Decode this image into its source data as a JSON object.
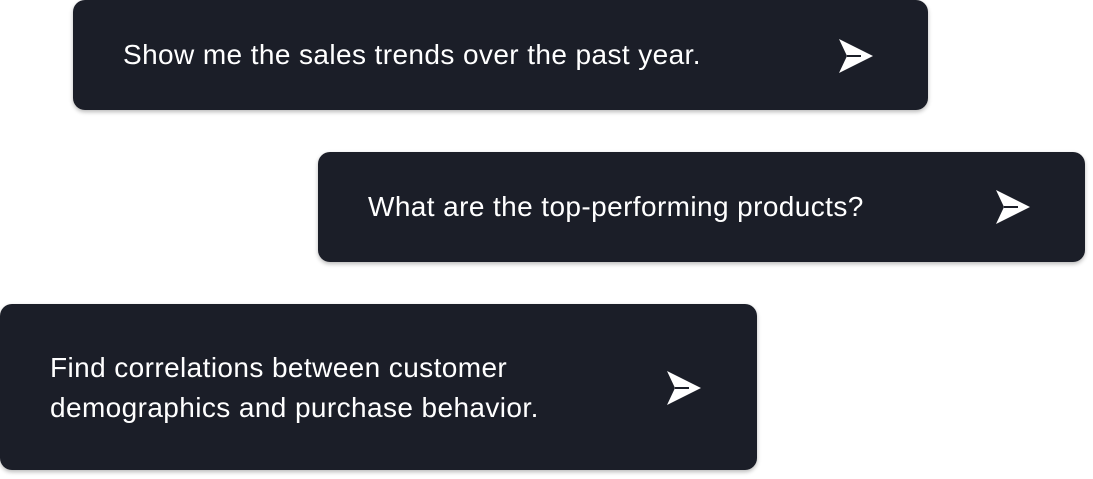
{
  "prompts": [
    {
      "text": "Show me the sales trends over the past year.",
      "icon": "send-icon"
    },
    {
      "text": "What are the top-performing products?",
      "icon": "send-icon"
    },
    {
      "text": "Find correlations between customer demographics and purchase behavior.",
      "icon": "send-icon"
    }
  ],
  "colors": {
    "card_background": "#1b1e28",
    "text": "#ffffff",
    "page_background": "#ffffff"
  }
}
